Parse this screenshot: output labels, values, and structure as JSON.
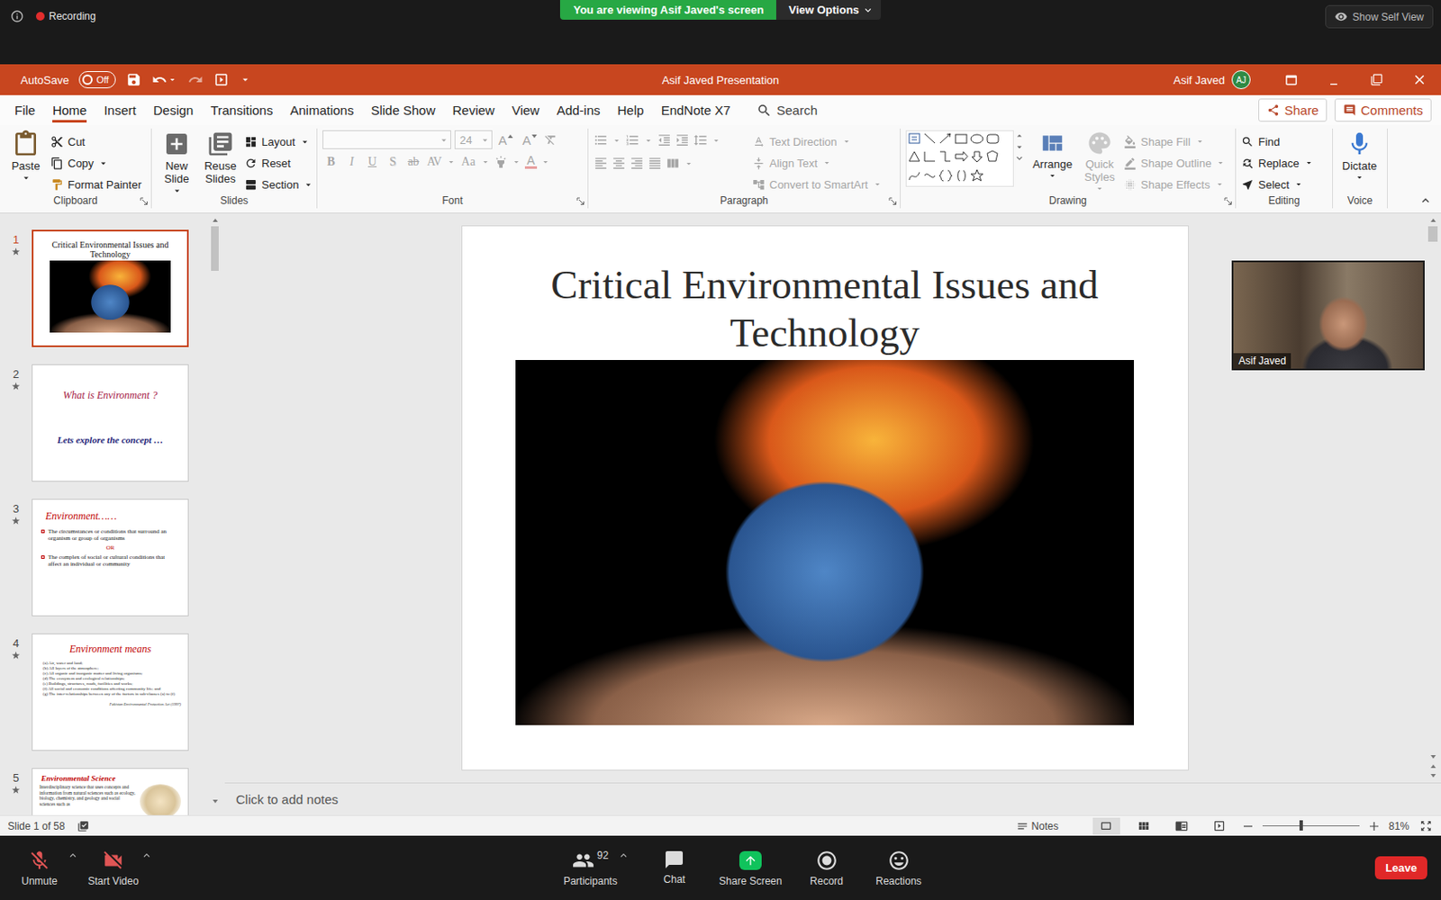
{
  "zoom_top": {
    "recording": "Recording",
    "banner": "You are viewing Asif Javed's screen",
    "view_options": "View Options",
    "self_view": "Show Self View"
  },
  "titlebar": {
    "autosave": "AutoSave",
    "autosave_toggle": {
      "label": "Off",
      "on": false
    },
    "title": "Asif Javed Presentation",
    "user": "Asif Javed",
    "initials": "AJ"
  },
  "menu": {
    "tabs": [
      {
        "label": "File",
        "selected": false
      },
      {
        "label": "Home",
        "selected": true
      },
      {
        "label": "Insert",
        "selected": false
      },
      {
        "label": "Design",
        "selected": false
      },
      {
        "label": "Transitions",
        "selected": false
      },
      {
        "label": "Animations",
        "selected": false
      },
      {
        "label": "Slide Show",
        "selected": false
      },
      {
        "label": "Review",
        "selected": false
      },
      {
        "label": "View",
        "selected": false
      },
      {
        "label": "Add-ins",
        "selected": false
      },
      {
        "label": "Help",
        "selected": false
      },
      {
        "label": "EndNote X7",
        "selected": false
      }
    ],
    "search": "Search",
    "share": "Share",
    "comments": "Comments"
  },
  "ribbon": {
    "clipboard": {
      "label": "Clipboard",
      "paste": "Paste",
      "commands": [
        {
          "label": "Cut",
          "disabled": false
        },
        {
          "label": "Copy",
          "disabled": false
        },
        {
          "label": "Format Painter",
          "disabled": false
        }
      ]
    },
    "slides": {
      "label": "Slides",
      "large": [
        "New Slide",
        "Reuse Slides"
      ],
      "commands": [
        "Layout",
        "Reset",
        "Section"
      ]
    },
    "font": {
      "label": "Font",
      "disabled": true,
      "size": "24",
      "size_buttons": [
        "A",
        "A"
      ],
      "format_buttons": [
        "B",
        "I",
        "U",
        "S",
        "ab",
        "AV",
        "Aa"
      ],
      "color_button": "A"
    },
    "paragraph": {
      "label": "Paragraph",
      "disabled": true,
      "commands": [
        "Text Direction",
        "Align Text",
        "Convert to SmartArt"
      ]
    },
    "drawing": {
      "label": "Drawing",
      "arrange": {
        "label": "Arrange",
        "disabled": false
      },
      "quick_styles": {
        "label": "Quick Styles",
        "disabled": true
      },
      "commands": [
        {
          "label": "Shape Fill",
          "disabled": true
        },
        {
          "label": "Shape Outline",
          "disabled": true
        },
        {
          "label": "Shape Effects",
          "disabled": true
        }
      ]
    },
    "editing": {
      "label": "Editing",
      "commands": [
        "Find",
        "Replace",
        "Select"
      ]
    },
    "voice": {
      "label": "Voice",
      "dictate": "Dictate"
    }
  },
  "thumbnails": [
    {
      "number": "1",
      "selected": true,
      "kind": "title-picture",
      "title": "Critical Environmental Issues and Technology"
    },
    {
      "number": "2",
      "selected": false,
      "kind": "title-subtitle",
      "title": "What is Environment ?",
      "subtitle": "Lets explore the concept …"
    },
    {
      "number": "3",
      "selected": false,
      "kind": "bullets",
      "title": "Environment……",
      "bullets": [
        "The circumstances or conditions that surround an organism or group of organisms",
        "The complex of social or cultural conditions that affect an individual or community"
      ],
      "separator": "OR"
    },
    {
      "number": "4",
      "selected": false,
      "kind": "list",
      "title": "Environment means",
      "items": [
        "(a) Air, water and land;",
        "(b) All layers of the atmosphere;",
        "(c) All organic and inorganic matter and living organisms;",
        "(d) The ecosystem and ecological relationships;",
        "(e) Buildings, structures, roads, facilities and works;",
        "(f) All social and economic conditions affecting community life; and",
        "(g) The inter-relationships between any of the factors in sub-clauses (a) to (f)"
      ],
      "source": "Pakistan Environmental Protection Act (1997)"
    },
    {
      "number": "5",
      "selected": false,
      "kind": "text-picture",
      "title": "Environmental Science",
      "text": "Interdisciplinary science that uses concepts and information from natural sciences such as ecology, biology, chemistry, and geology and social sciences such as"
    }
  ],
  "slide": {
    "title": "Critical Environmental Issues and Technology"
  },
  "notes": {
    "placeholder": "Click to add notes"
  },
  "status_bar": {
    "slide_info": "Slide 1 of 58",
    "notes": "Notes",
    "zoom": "81%",
    "zoom_level": 0.4,
    "views": [
      {
        "kind": "normal",
        "selected": true
      },
      {
        "kind": "sorter",
        "selected": false
      },
      {
        "kind": "reading",
        "selected": false
      },
      {
        "kind": "slideshow",
        "selected": false
      }
    ]
  },
  "video_tile": {
    "name": "Asif Javed"
  },
  "zoom_bottom": {
    "controls": [
      {
        "label": "Unmute",
        "kind": "mic"
      },
      {
        "label": "Start Video",
        "kind": "video"
      }
    ],
    "center": [
      {
        "label": "Participants",
        "kind": "participants",
        "count": "92"
      },
      {
        "label": "Chat",
        "kind": "chat"
      },
      {
        "label": "Share Screen",
        "kind": "share"
      },
      {
        "label": "Record",
        "kind": "record"
      },
      {
        "label": "Reactions",
        "kind": "reactions"
      }
    ],
    "leave": "Leave"
  }
}
